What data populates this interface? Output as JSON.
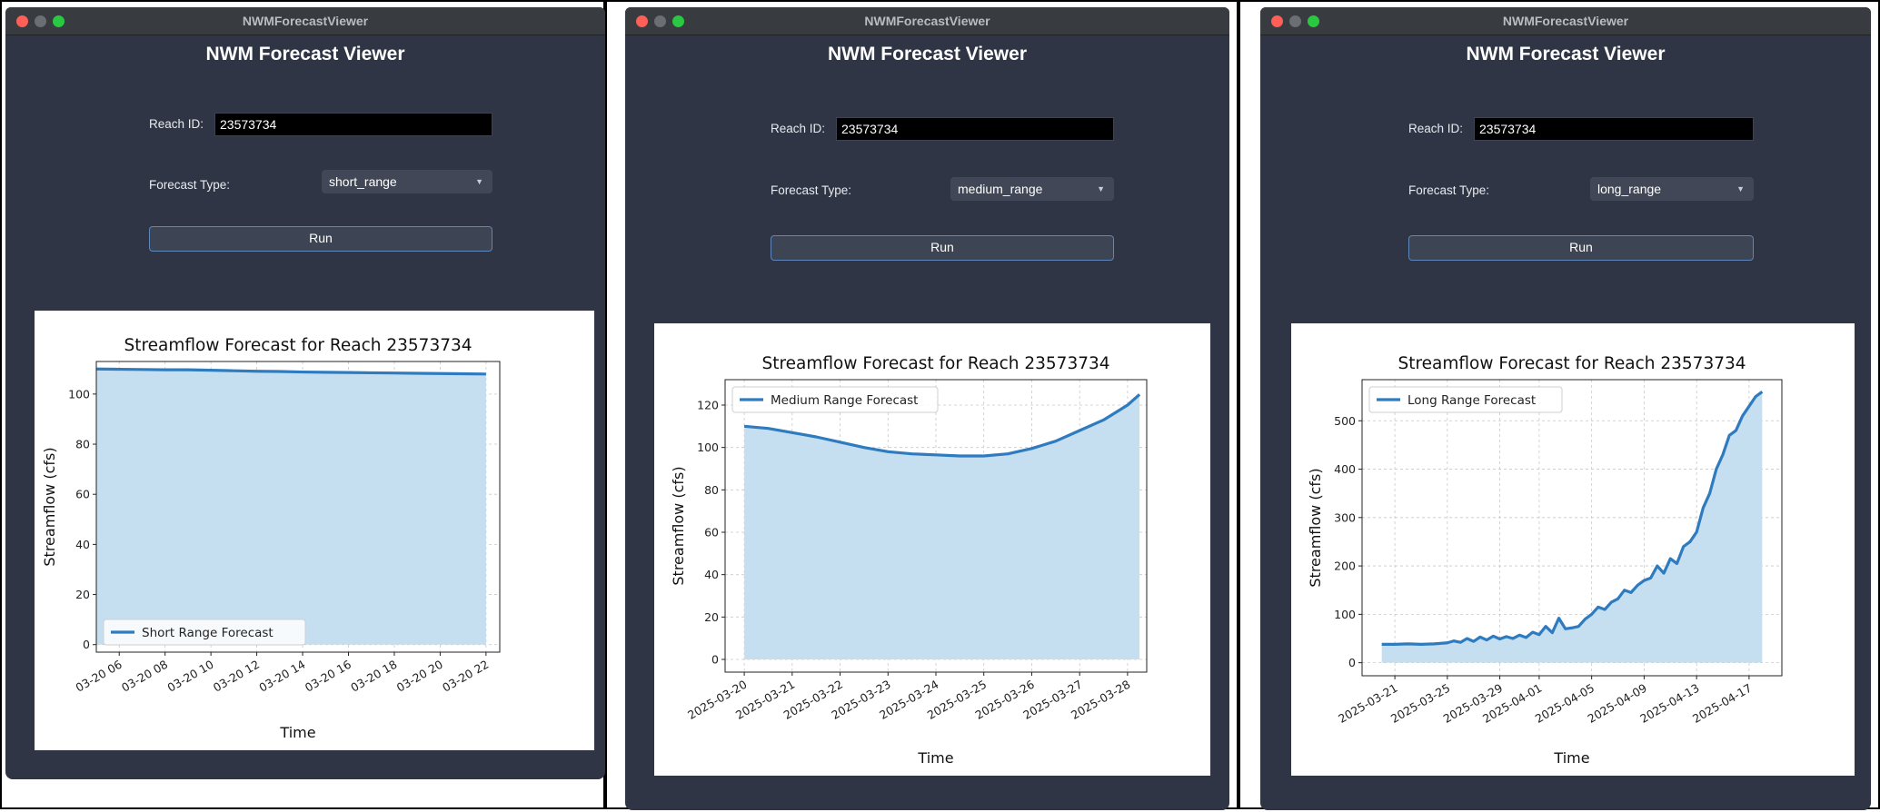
{
  "panels": [
    {
      "window_title": "NWMForecastViewer",
      "app_title": "NWM Forecast Viewer",
      "reach_label": "Reach ID:",
      "reach_value": "23573734",
      "forecast_label": "Forecast Type:",
      "forecast_value": "short_range",
      "run_label": "Run"
    },
    {
      "window_title": "NWMForecastViewer",
      "app_title": "NWM Forecast Viewer",
      "reach_label": "Reach ID:",
      "reach_value": "23573734",
      "forecast_label": "Forecast Type:",
      "forecast_value": "medium_range",
      "run_label": "Run"
    },
    {
      "window_title": "NWMForecastViewer",
      "app_title": "NWM Forecast Viewer",
      "reach_label": "Reach ID:",
      "reach_value": "23573734",
      "forecast_label": "Forecast Type:",
      "forecast_value": "long_range",
      "run_label": "Run"
    }
  ],
  "colors": {
    "window_bg": "#2f3544",
    "line": "#2e7bbf",
    "fill": "#c6dff0",
    "button_border": "#5f86b8"
  },
  "chart_data": [
    {
      "type": "area",
      "title": "Streamflow Forecast for Reach 23573734",
      "xlabel": "Time",
      "ylabel": "Streamflow (cfs)",
      "legend": {
        "label": "Short Range Forecast",
        "position": "lower-left"
      },
      "grid": true,
      "xlim": [
        5,
        22.6
      ],
      "ylim": [
        -3,
        113
      ],
      "xticks": [
        6,
        8,
        10,
        12,
        14,
        16,
        18,
        20,
        22
      ],
      "xtick_labels": [
        "03-20 06",
        "03-20 08",
        "03-20 10",
        "03-20 12",
        "03-20 14",
        "03-20 16",
        "03-20 18",
        "03-20 20",
        "03-20 22"
      ],
      "yticks": [
        0,
        20,
        40,
        60,
        80,
        100
      ],
      "x_unit": "hour of 2025-03-20",
      "x": [
        5,
        6,
        7,
        8,
        9,
        10,
        11,
        12,
        13,
        14,
        15,
        16,
        17,
        18,
        19,
        20,
        21,
        22
      ],
      "y": [
        110.0,
        109.9,
        109.8,
        109.7,
        109.7,
        109.5,
        109.3,
        109.1,
        109.0,
        108.8,
        108.7,
        108.6,
        108.5,
        108.4,
        108.3,
        108.2,
        108.1,
        108.0
      ]
    },
    {
      "type": "area",
      "title": "Streamflow Forecast for Reach 23573734",
      "xlabel": "Time",
      "ylabel": "Streamflow (cfs)",
      "legend": {
        "label": "Medium Range Forecast",
        "position": "top-left"
      },
      "grid": true,
      "xlim": [
        -0.4,
        8.4
      ],
      "ylim": [
        -6,
        132
      ],
      "xticks": [
        0,
        1,
        2,
        3,
        4,
        5,
        6,
        7,
        8
      ],
      "xtick_labels": [
        "2025-03-20",
        "2025-03-21",
        "2025-03-22",
        "2025-03-23",
        "2025-03-24",
        "2025-03-25",
        "2025-03-26",
        "2025-03-27",
        "2025-03-28"
      ],
      "yticks": [
        0,
        20,
        40,
        60,
        80,
        100,
        120
      ],
      "x_unit": "days after 2025-03-20",
      "x": [
        0,
        0.5,
        1,
        1.5,
        2,
        2.5,
        3,
        3.5,
        4,
        4.5,
        5,
        5.5,
        6,
        6.5,
        7,
        7.5,
        8,
        8.25
      ],
      "y": [
        110,
        109,
        107,
        105,
        102.5,
        100,
        98,
        97,
        96.5,
        96,
        96,
        97,
        99.5,
        103,
        108,
        113,
        120,
        125
      ]
    },
    {
      "type": "area",
      "title": "Streamflow Forecast for Reach 23573734",
      "xlabel": "Time",
      "ylabel": "Streamflow (cfs)",
      "legend": {
        "label": "Long Range Forecast",
        "position": "top-left"
      },
      "grid": true,
      "xlim": [
        -1.5,
        30.5
      ],
      "ylim": [
        -27,
        585
      ],
      "xticks": [
        1,
        5,
        9,
        12,
        16,
        20,
        24,
        28
      ],
      "xtick_labels": [
        "2025-03-21",
        "2025-03-25",
        "2025-03-29",
        "2025-04-01",
        "2025-04-05",
        "2025-04-09",
        "2025-04-13",
        "2025-04-17"
      ],
      "yticks": [
        0,
        100,
        200,
        300,
        400,
        500
      ],
      "x_unit": "days after 2025-03-20",
      "x": [
        0,
        1,
        2,
        3,
        4,
        5,
        5.5,
        6,
        6.5,
        7,
        7.5,
        8,
        8.5,
        9,
        9.5,
        10,
        10.5,
        11,
        11.5,
        12,
        12.5,
        13,
        13.5,
        14,
        14.5,
        15,
        15.5,
        16,
        16.5,
        17,
        17.5,
        18,
        18.5,
        19,
        19.5,
        20,
        20.5,
        21,
        21.5,
        22,
        22.5,
        23,
        23.5,
        24,
        24.5,
        25,
        25.5,
        26,
        26.5,
        27,
        27.5,
        28,
        28.5,
        29
      ],
      "y": [
        38,
        38,
        39,
        38,
        39,
        41,
        45,
        42,
        50,
        44,
        53,
        47,
        55,
        49,
        54,
        50,
        57,
        52,
        63,
        58,
        75,
        62,
        92,
        70,
        72,
        75,
        90,
        100,
        115,
        110,
        125,
        132,
        150,
        145,
        160,
        170,
        175,
        200,
        185,
        215,
        205,
        240,
        250,
        270,
        320,
        350,
        400,
        430,
        470,
        480,
        510,
        530,
        550,
        560
      ]
    }
  ]
}
